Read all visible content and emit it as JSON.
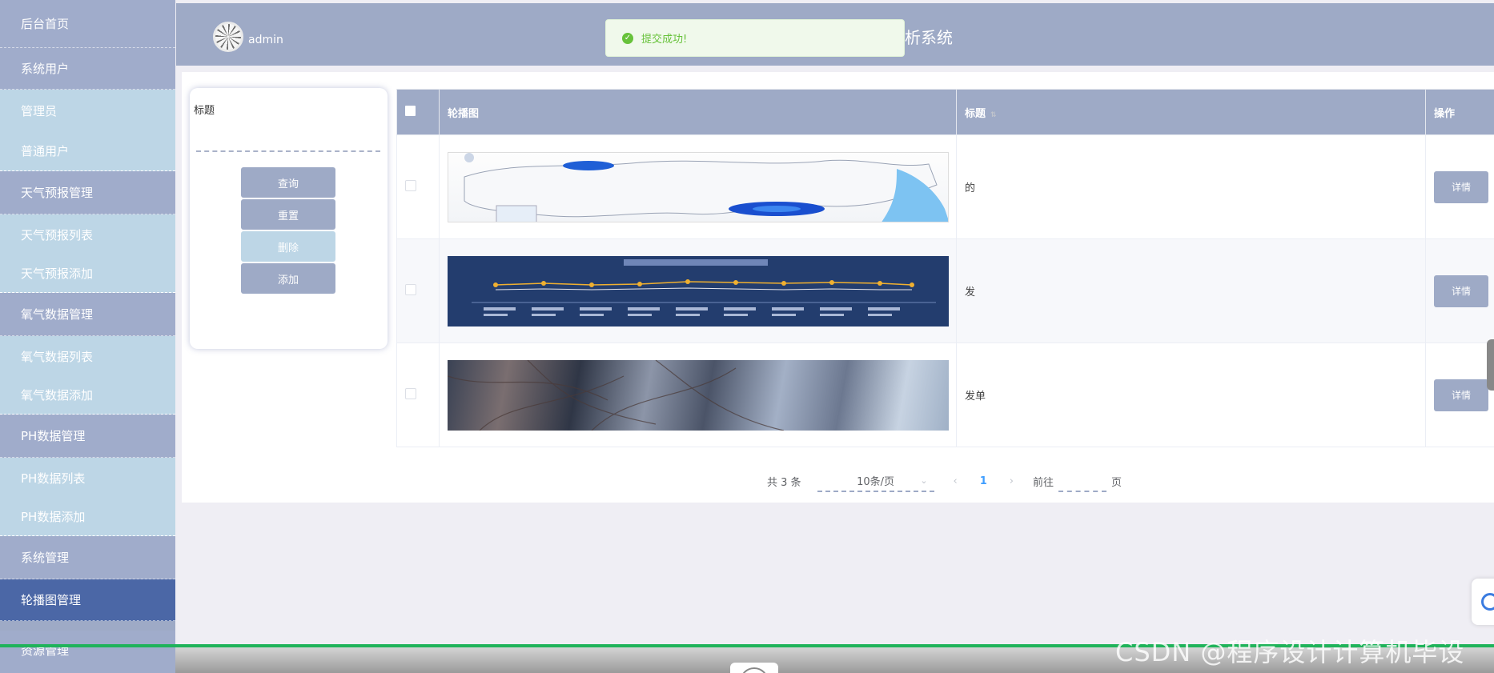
{
  "sidebar": {
    "items": [
      {
        "label": "后台首页",
        "type": "group"
      },
      {
        "label": "系统用户",
        "type": "group"
      },
      {
        "label": "管理员",
        "type": "sub"
      },
      {
        "label": "普通用户",
        "type": "sub-last"
      },
      {
        "label": "天气预报管理",
        "type": "group"
      },
      {
        "label": "天气预报列表",
        "type": "sub"
      },
      {
        "label": "天气预报添加",
        "type": "sub-last"
      },
      {
        "label": "氧气数据管理",
        "type": "group"
      },
      {
        "label": "氧气数据列表",
        "type": "sub"
      },
      {
        "label": "氧气数据添加",
        "type": "sub-last"
      },
      {
        "label": "PH数据管理",
        "type": "group"
      },
      {
        "label": "PH数据列表",
        "type": "sub"
      },
      {
        "label": "PH数据添加",
        "type": "sub-last"
      },
      {
        "label": "系统管理",
        "type": "group"
      },
      {
        "label": "轮播图管理",
        "type": "active"
      },
      {
        "label": "资源管理",
        "type": "group"
      }
    ]
  },
  "header": {
    "username": "admin",
    "title_visible": "析系统"
  },
  "toast": {
    "icon": "success-check-icon",
    "message": "提交成功!",
    "color": "#67c23a"
  },
  "search": {
    "title_label": "标题",
    "title_value": "",
    "buttons": {
      "query": "查询",
      "reset": "重置",
      "delete": "删除",
      "add": "添加"
    }
  },
  "table": {
    "headers": {
      "image": "轮播图",
      "title": "标题",
      "action": "操作"
    },
    "rows": [
      {
        "image": "map-image",
        "title": "的",
        "action": "详情"
      },
      {
        "image": "chart-image",
        "title": "发",
        "action": "详情"
      },
      {
        "image": "photo-image",
        "title": "发单",
        "action": "详情"
      }
    ]
  },
  "pagination": {
    "total": "共 3 条",
    "page_size": "10条/页",
    "current_page": "1",
    "goto_prefix": "前往",
    "goto_suffix": "页"
  },
  "watermark": "CSDN @程序设计计算机毕设",
  "colors": {
    "primary": "#9eaac6",
    "active_nav": "#4b67a6",
    "sub_nav": "#bdd6e6",
    "success": "#67c23a",
    "page_link": "#409eff"
  }
}
